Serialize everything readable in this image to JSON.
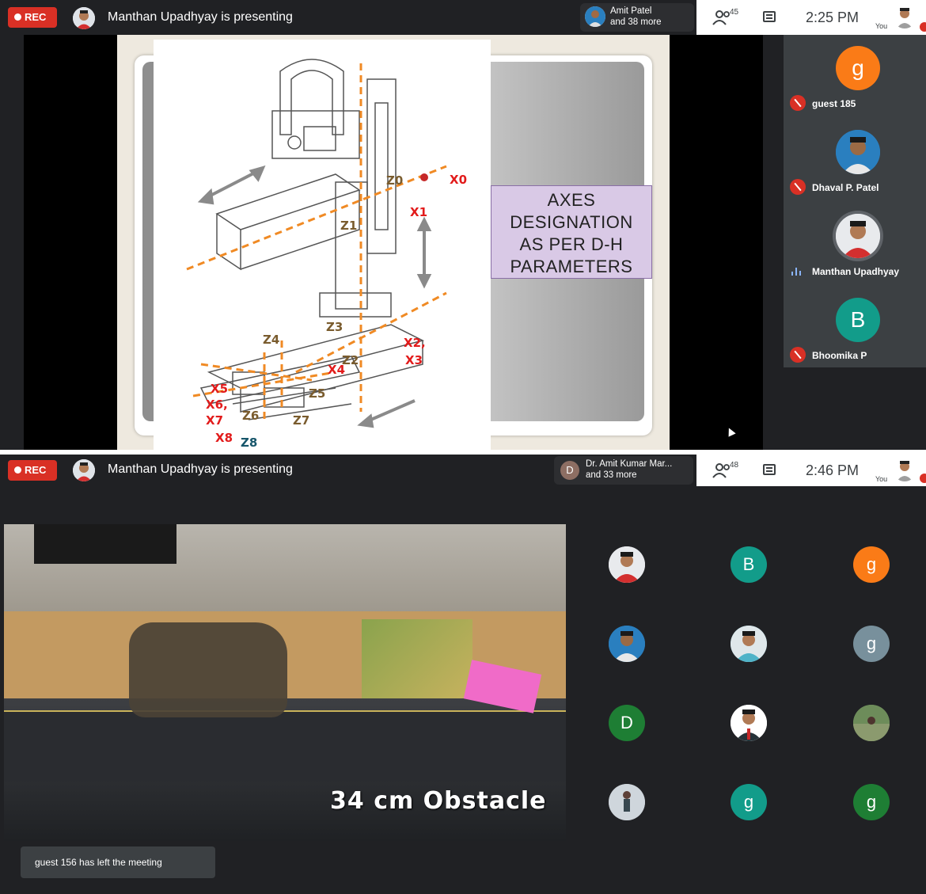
{
  "top_meeting": {
    "rec_label": "REC",
    "presenting_text": "Manthan Upadhyay is presenting",
    "others_name": "Amit Patel",
    "others_more": "and 38 more",
    "people_count": "45",
    "time": "2:25 PM",
    "you_label": "You",
    "slide": {
      "axis_labels": [
        "Z0",
        "X0",
        "X1",
        "Z1",
        "Z2",
        "Z3",
        "Z4",
        "X2,",
        "X3",
        "X4",
        "X5",
        "X6,",
        "X7",
        "X8",
        "Z5",
        "Z6",
        "Z7",
        "Z8"
      ],
      "box_line1": "AXES",
      "box_line2": "DESIGNATION",
      "box_line3": "AS PER D-H",
      "box_line4": "PARAMETERS"
    },
    "participants": [
      {
        "name": "guest 185",
        "initial": "g",
        "color": "#fa7b17",
        "muted": true
      },
      {
        "name": "Dhaval P. Patel",
        "initial": "",
        "color": "#2a7fbf",
        "muted": true
      },
      {
        "name": "Manthan Upadhyay",
        "initial": "",
        "color": "#e8eaed",
        "muted": false
      },
      {
        "name": "Bhoomika P",
        "initial": "B",
        "color": "#129c8a",
        "muted": true
      }
    ]
  },
  "bottom_meeting": {
    "rec_label": "REC",
    "presenting_text": "Manthan Upadhyay is presenting",
    "others_initial": "D",
    "others_name": "Dr. Amit Kumar Mar...",
    "others_more": "and 33 more",
    "people_count": "48",
    "time": "2:46 PM",
    "you_label": "You",
    "video_caption": "34 cm Obstacle",
    "grid_tiles": [
      {
        "initial": "",
        "color": "#e8eaed"
      },
      {
        "initial": "B",
        "color": "#129c8a"
      },
      {
        "initial": "g",
        "color": "#fa7b17"
      },
      {
        "initial": "",
        "color": "#2a7fbf"
      },
      {
        "initial": "",
        "color": "#4fb3c8"
      },
      {
        "initial": "g",
        "color": "#78909c"
      },
      {
        "initial": "D",
        "color": "#1e7e34"
      },
      {
        "initial": "",
        "color": "#ffffff"
      },
      {
        "initial": "",
        "color": "#6d8c5a"
      },
      {
        "initial": "",
        "color": "#9aa3ab"
      },
      {
        "initial": "g",
        "color": "#129c8a"
      },
      {
        "initial": "g",
        "color": "#1e7e34"
      }
    ],
    "toast": "guest 156 has left the meeting"
  }
}
